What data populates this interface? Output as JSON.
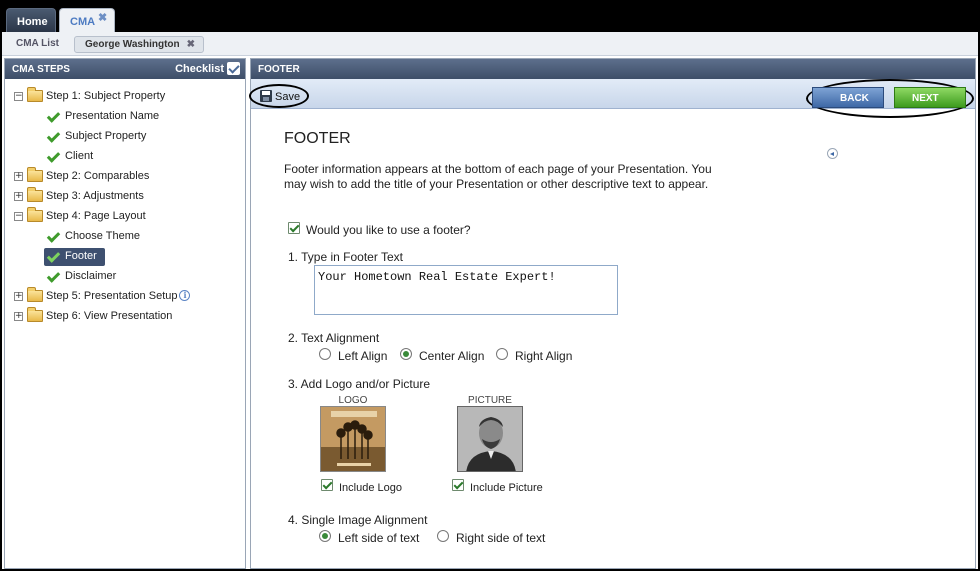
{
  "tabs": {
    "home": "Home",
    "cma": "CMA"
  },
  "subtabs": {
    "list": "CMA List",
    "active": "George Washington"
  },
  "steps_panel": {
    "title": "CMA STEPS",
    "checklist": "Checklist",
    "steps": [
      {
        "label": "Step 1: Subject Property",
        "expanded": true,
        "children": [
          "Presentation Name",
          "Subject Property",
          "Client"
        ]
      },
      {
        "label": "Step 2: Comparables",
        "expanded": false
      },
      {
        "label": "Step 3: Adjustments",
        "expanded": false
      },
      {
        "label": "Step 4: Page Layout",
        "expanded": true,
        "children": [
          "Choose Theme",
          "Footer",
          "Disclaimer"
        ]
      },
      {
        "label": "Step 5: Presentation Setup",
        "expanded": false
      },
      {
        "label": "Step 6: View Presentation",
        "expanded": false
      }
    ],
    "selected": "Footer"
  },
  "main": {
    "header": "FOOTER",
    "toolbar": {
      "save": "Save",
      "back": "BACK",
      "next": "NEXT"
    },
    "title": "FOOTER",
    "description": "Footer information appears at the bottom of each page of your Presentation. You may wish to add the title of your Presentation or other descriptive text to appear.",
    "use_footer": {
      "label": "Would you like to use a footer?",
      "checked": true
    },
    "q1": "1. Type in Footer Text",
    "footer_text": "Your Hometown Real Estate Expert!",
    "q2": "2. Text Alignment",
    "alignment": {
      "left": "Left Align",
      "center": "Center Align",
      "right": "Right Align",
      "selected": "center"
    },
    "q3": "3. Add Logo and/or Picture",
    "logo": {
      "caption": "LOGO",
      "include": "Include Logo",
      "checked": true
    },
    "picture": {
      "caption": "PICTURE",
      "include": "Include Picture",
      "checked": true
    },
    "q4": "4. Single Image Alignment",
    "image_alignment": {
      "left": "Left side of text",
      "right": "Right side of text",
      "selected": "left"
    }
  }
}
